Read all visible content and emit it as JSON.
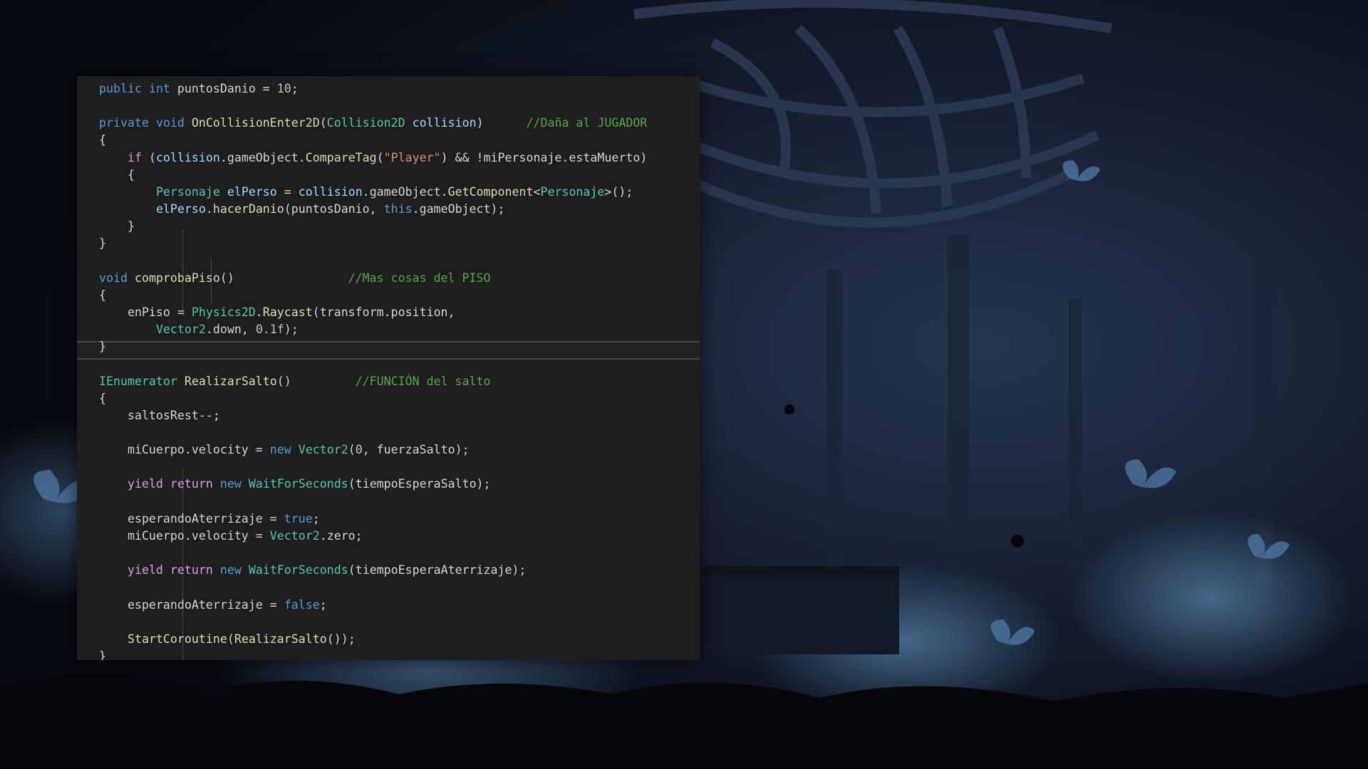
{
  "theme": {
    "keyword": "#569cd6",
    "type": "#4ec9b0",
    "method": "#dcdcaa",
    "parameter": "#9cdcfe",
    "string": "#ce9178",
    "number": "#b5cea8",
    "comment": "#57a64a",
    "control": "#d8a0df",
    "text": "#d4d4d4",
    "background": "#1e1e1e"
  },
  "code": {
    "language": "C#",
    "lines": [
      [
        [
          "public",
          "keyword"
        ],
        [
          " ",
          "text"
        ],
        [
          "int",
          "keyword"
        ],
        [
          " puntosDanio = ",
          "text"
        ],
        [
          "10",
          "number"
        ],
        [
          ";",
          "text"
        ]
      ],
      [],
      [
        [
          "private",
          "keyword"
        ],
        [
          " ",
          "text"
        ],
        [
          "void",
          "keyword"
        ],
        [
          " ",
          "text"
        ],
        [
          "OnCollisionEnter2D",
          "method"
        ],
        [
          "(",
          "text"
        ],
        [
          "Collision2D",
          "type"
        ],
        [
          " ",
          "text"
        ],
        [
          "collision",
          "parameter"
        ],
        [
          ")      ",
          "text"
        ],
        [
          "//Daña al JUGADOR",
          "comment"
        ]
      ],
      [
        [
          "{",
          "text"
        ]
      ],
      [
        [
          "    ",
          "text"
        ],
        [
          "if",
          "control"
        ],
        [
          " (",
          "text"
        ],
        [
          "collision",
          "parameter"
        ],
        [
          ".gameObject.",
          "text"
        ],
        [
          "CompareTag",
          "method"
        ],
        [
          "(",
          "text"
        ],
        [
          "\"Player\"",
          "string"
        ],
        [
          ") && !miPersonaje.estaMuerto)",
          "text"
        ]
      ],
      [
        [
          "    {",
          "text"
        ]
      ],
      [
        [
          "        ",
          "text"
        ],
        [
          "Personaje",
          "type"
        ],
        [
          " ",
          "text"
        ],
        [
          "elPerso",
          "parameter"
        ],
        [
          " = ",
          "text"
        ],
        [
          "collision",
          "parameter"
        ],
        [
          ".gameObject.",
          "text"
        ],
        [
          "GetComponent",
          "method"
        ],
        [
          "<",
          "text"
        ],
        [
          "Personaje",
          "type"
        ],
        [
          ">();",
          "text"
        ]
      ],
      [
        [
          "        ",
          "text"
        ],
        [
          "elPerso",
          "parameter"
        ],
        [
          ".",
          "text"
        ],
        [
          "hacerDanio",
          "method"
        ],
        [
          "(puntosDanio, ",
          "text"
        ],
        [
          "this",
          "keyword"
        ],
        [
          ".gameObject);",
          "text"
        ]
      ],
      [
        [
          "    }",
          "text"
        ]
      ],
      [
        [
          "}",
          "text"
        ]
      ],
      [],
      [
        [
          "void",
          "keyword"
        ],
        [
          " ",
          "text"
        ],
        [
          "comprobaPiso",
          "method"
        ],
        [
          "()                ",
          "text"
        ],
        [
          "//Mas cosas del PISO",
          "comment"
        ]
      ],
      [
        [
          "{",
          "text"
        ]
      ],
      [
        [
          "    enPiso = ",
          "text"
        ],
        [
          "Physics2D",
          "type"
        ],
        [
          ".",
          "text"
        ],
        [
          "Raycast",
          "method"
        ],
        [
          "(transform.position,",
          "text"
        ]
      ],
      [
        [
          "        ",
          "text"
        ],
        [
          "Vector2",
          "type"
        ],
        [
          ".down, ",
          "text"
        ],
        [
          "0.1f",
          "number"
        ],
        [
          ");",
          "text"
        ]
      ],
      [
        [
          "}",
          "text"
        ]
      ],
      [],
      [
        [
          "IEnumerator",
          "type"
        ],
        [
          " ",
          "text"
        ],
        [
          "RealizarSalto",
          "method"
        ],
        [
          "()         ",
          "text"
        ],
        [
          "//FUNCIÓN del salto",
          "comment"
        ]
      ],
      [
        [
          "{",
          "text"
        ]
      ],
      [
        [
          "    saltosRest--;",
          "text"
        ]
      ],
      [],
      [
        [
          "    miCuerpo.velocity = ",
          "text"
        ],
        [
          "new",
          "keyword"
        ],
        [
          " ",
          "text"
        ],
        [
          "Vector2",
          "type"
        ],
        [
          "(",
          "text"
        ],
        [
          "0",
          "number"
        ],
        [
          ", fuerzaSalto);",
          "text"
        ]
      ],
      [],
      [
        [
          "    ",
          "text"
        ],
        [
          "yield",
          "control"
        ],
        [
          " ",
          "text"
        ],
        [
          "return",
          "control"
        ],
        [
          " ",
          "text"
        ],
        [
          "new",
          "keyword"
        ],
        [
          " ",
          "text"
        ],
        [
          "WaitForSeconds",
          "type"
        ],
        [
          "(tiempoEsperaSalto);",
          "text"
        ]
      ],
      [],
      [
        [
          "    esperandoAterrizaje = ",
          "text"
        ],
        [
          "true",
          "keyword"
        ],
        [
          ";",
          "text"
        ]
      ],
      [
        [
          "    miCuerpo.velocity = ",
          "text"
        ],
        [
          "Vector2",
          "type"
        ],
        [
          ".zero;",
          "text"
        ]
      ],
      [],
      [
        [
          "    ",
          "text"
        ],
        [
          "yield",
          "control"
        ],
        [
          " ",
          "text"
        ],
        [
          "return",
          "control"
        ],
        [
          " ",
          "text"
        ],
        [
          "new",
          "keyword"
        ],
        [
          " ",
          "text"
        ],
        [
          "WaitForSeconds",
          "type"
        ],
        [
          "(tiempoEsperaAterrizaje);",
          "text"
        ]
      ],
      [],
      [
        [
          "    esperandoAterrizaje = ",
          "text"
        ],
        [
          "false",
          "keyword"
        ],
        [
          ";",
          "text"
        ]
      ],
      [],
      [
        [
          "    ",
          "text"
        ],
        [
          "StartCoroutine",
          "method"
        ],
        [
          "(",
          "text"
        ],
        [
          "RealizarSalto",
          "method"
        ],
        [
          "());",
          "text"
        ]
      ],
      [
        [
          "}",
          "text"
        ]
      ]
    ]
  }
}
